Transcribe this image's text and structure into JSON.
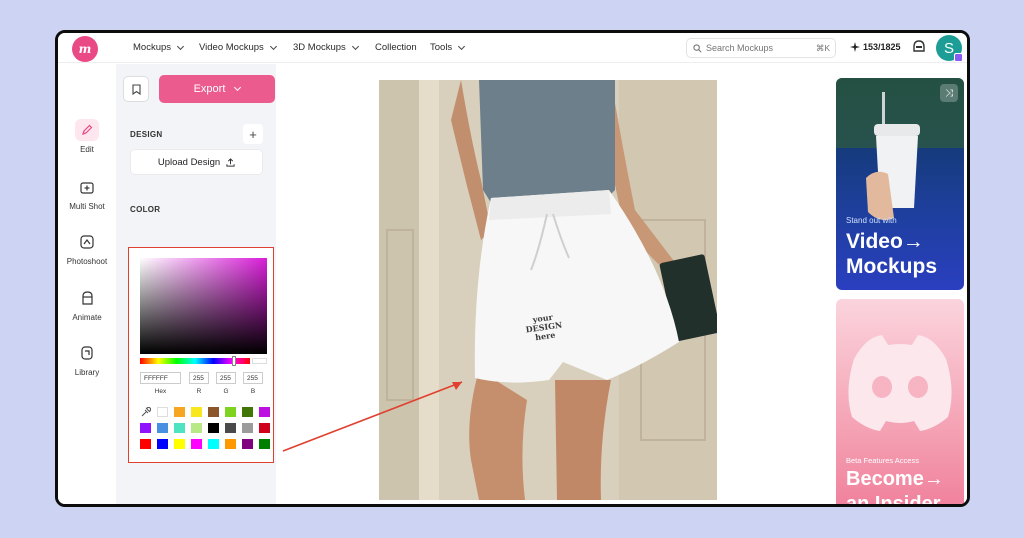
{
  "nav": {
    "items": [
      {
        "label": "Mockups",
        "has_menu": true
      },
      {
        "label": "Video Mockups",
        "has_menu": true
      },
      {
        "label": "3D Mockups",
        "has_menu": true
      },
      {
        "label": "Collection",
        "has_menu": false
      },
      {
        "label": "Tools",
        "has_menu": true
      }
    ],
    "search_placeholder": "Search Mockups",
    "search_shortcut": "⌘K",
    "credits": "153/1825",
    "avatar_initial": "S"
  },
  "sidebar": {
    "items": [
      {
        "label": "Edit",
        "icon": "pencil-icon",
        "active": true
      },
      {
        "label": "Multi Shot",
        "icon": "multi-shot-icon",
        "active": false
      },
      {
        "label": "Photoshoot",
        "icon": "photoshoot-icon",
        "active": false
      },
      {
        "label": "Animate",
        "icon": "animate-icon",
        "active": false
      },
      {
        "label": "Library",
        "icon": "library-icon",
        "active": false
      }
    ]
  },
  "panel": {
    "export_label": "Export",
    "design_section": "DESIGN",
    "add_label": "+",
    "upload_label": "Upload Design",
    "color_section": "COLOR",
    "color_value": "#FFFFFF"
  },
  "picker": {
    "hex": "FFFFFF",
    "r": "255",
    "g": "255",
    "b": "255",
    "hex_label": "Hex",
    "r_label": "R",
    "g_label": "G",
    "b_label": "B",
    "hue_fraction": 0.85,
    "swatches": [
      "#ffffff",
      "#f5a623",
      "#f8e71c",
      "#8b572a",
      "#7ed321",
      "#417505",
      "#bd10e0",
      "#9013fe",
      "#4a90e2",
      "#50e3c2",
      "#b8e986",
      "#000000",
      "#4a4a4a",
      "#9b9b9b",
      "#d0021b",
      "#ff0000",
      "#0000ff",
      "#ffff00",
      "#ff00ff",
      "#00ffff",
      "#ff9900",
      "#800080",
      "#008000"
    ]
  },
  "canvas": {
    "design_placeholder": "your\nDESIGN\nhere"
  },
  "promo": {
    "card1_sub": "Stand out with",
    "card1_title1": "Video→",
    "card1_title2": "Mockups",
    "card2_sub": "Beta Features Access",
    "card2_title1": "Become→",
    "card2_title2": "an Insider"
  }
}
